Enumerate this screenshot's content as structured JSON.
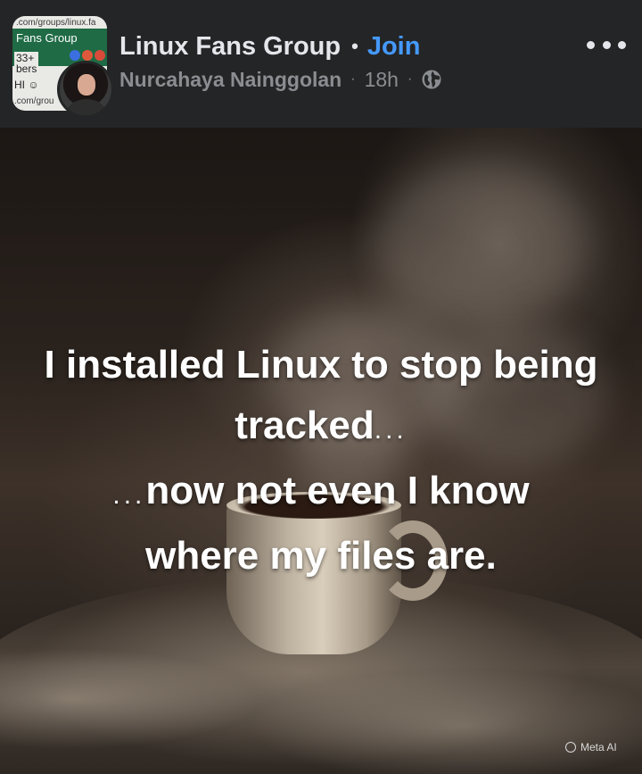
{
  "thumbnail": {
    "url_top": ".com/groups/linux.fa",
    "group_name": "Fans Group",
    "member_count": "33+",
    "members_label": "bers",
    "greeting": "HI ☺",
    "url_bottom": ".com/grou"
  },
  "post": {
    "group_name": "Linux Fans Group",
    "dot": "•",
    "join_label": "Join",
    "author": "Nurcahaya Nainggolan",
    "separator": "·",
    "time": "18h",
    "privacy_icon": "globe-icon",
    "more_icon": "more-options-icon"
  },
  "image": {
    "line1": "I installed Linux to stop being",
    "line2_text": "tracked",
    "line2_ellipsis": "...",
    "line3_ellipsis": "...",
    "line3_text": "now not even I know",
    "line4": "where my files are.",
    "watermark": "Meta AI"
  },
  "colors": {
    "background": "#242526",
    "primary_text": "#e4e6eb",
    "secondary_text": "#8a8d91",
    "join_link": "#4599ff"
  }
}
